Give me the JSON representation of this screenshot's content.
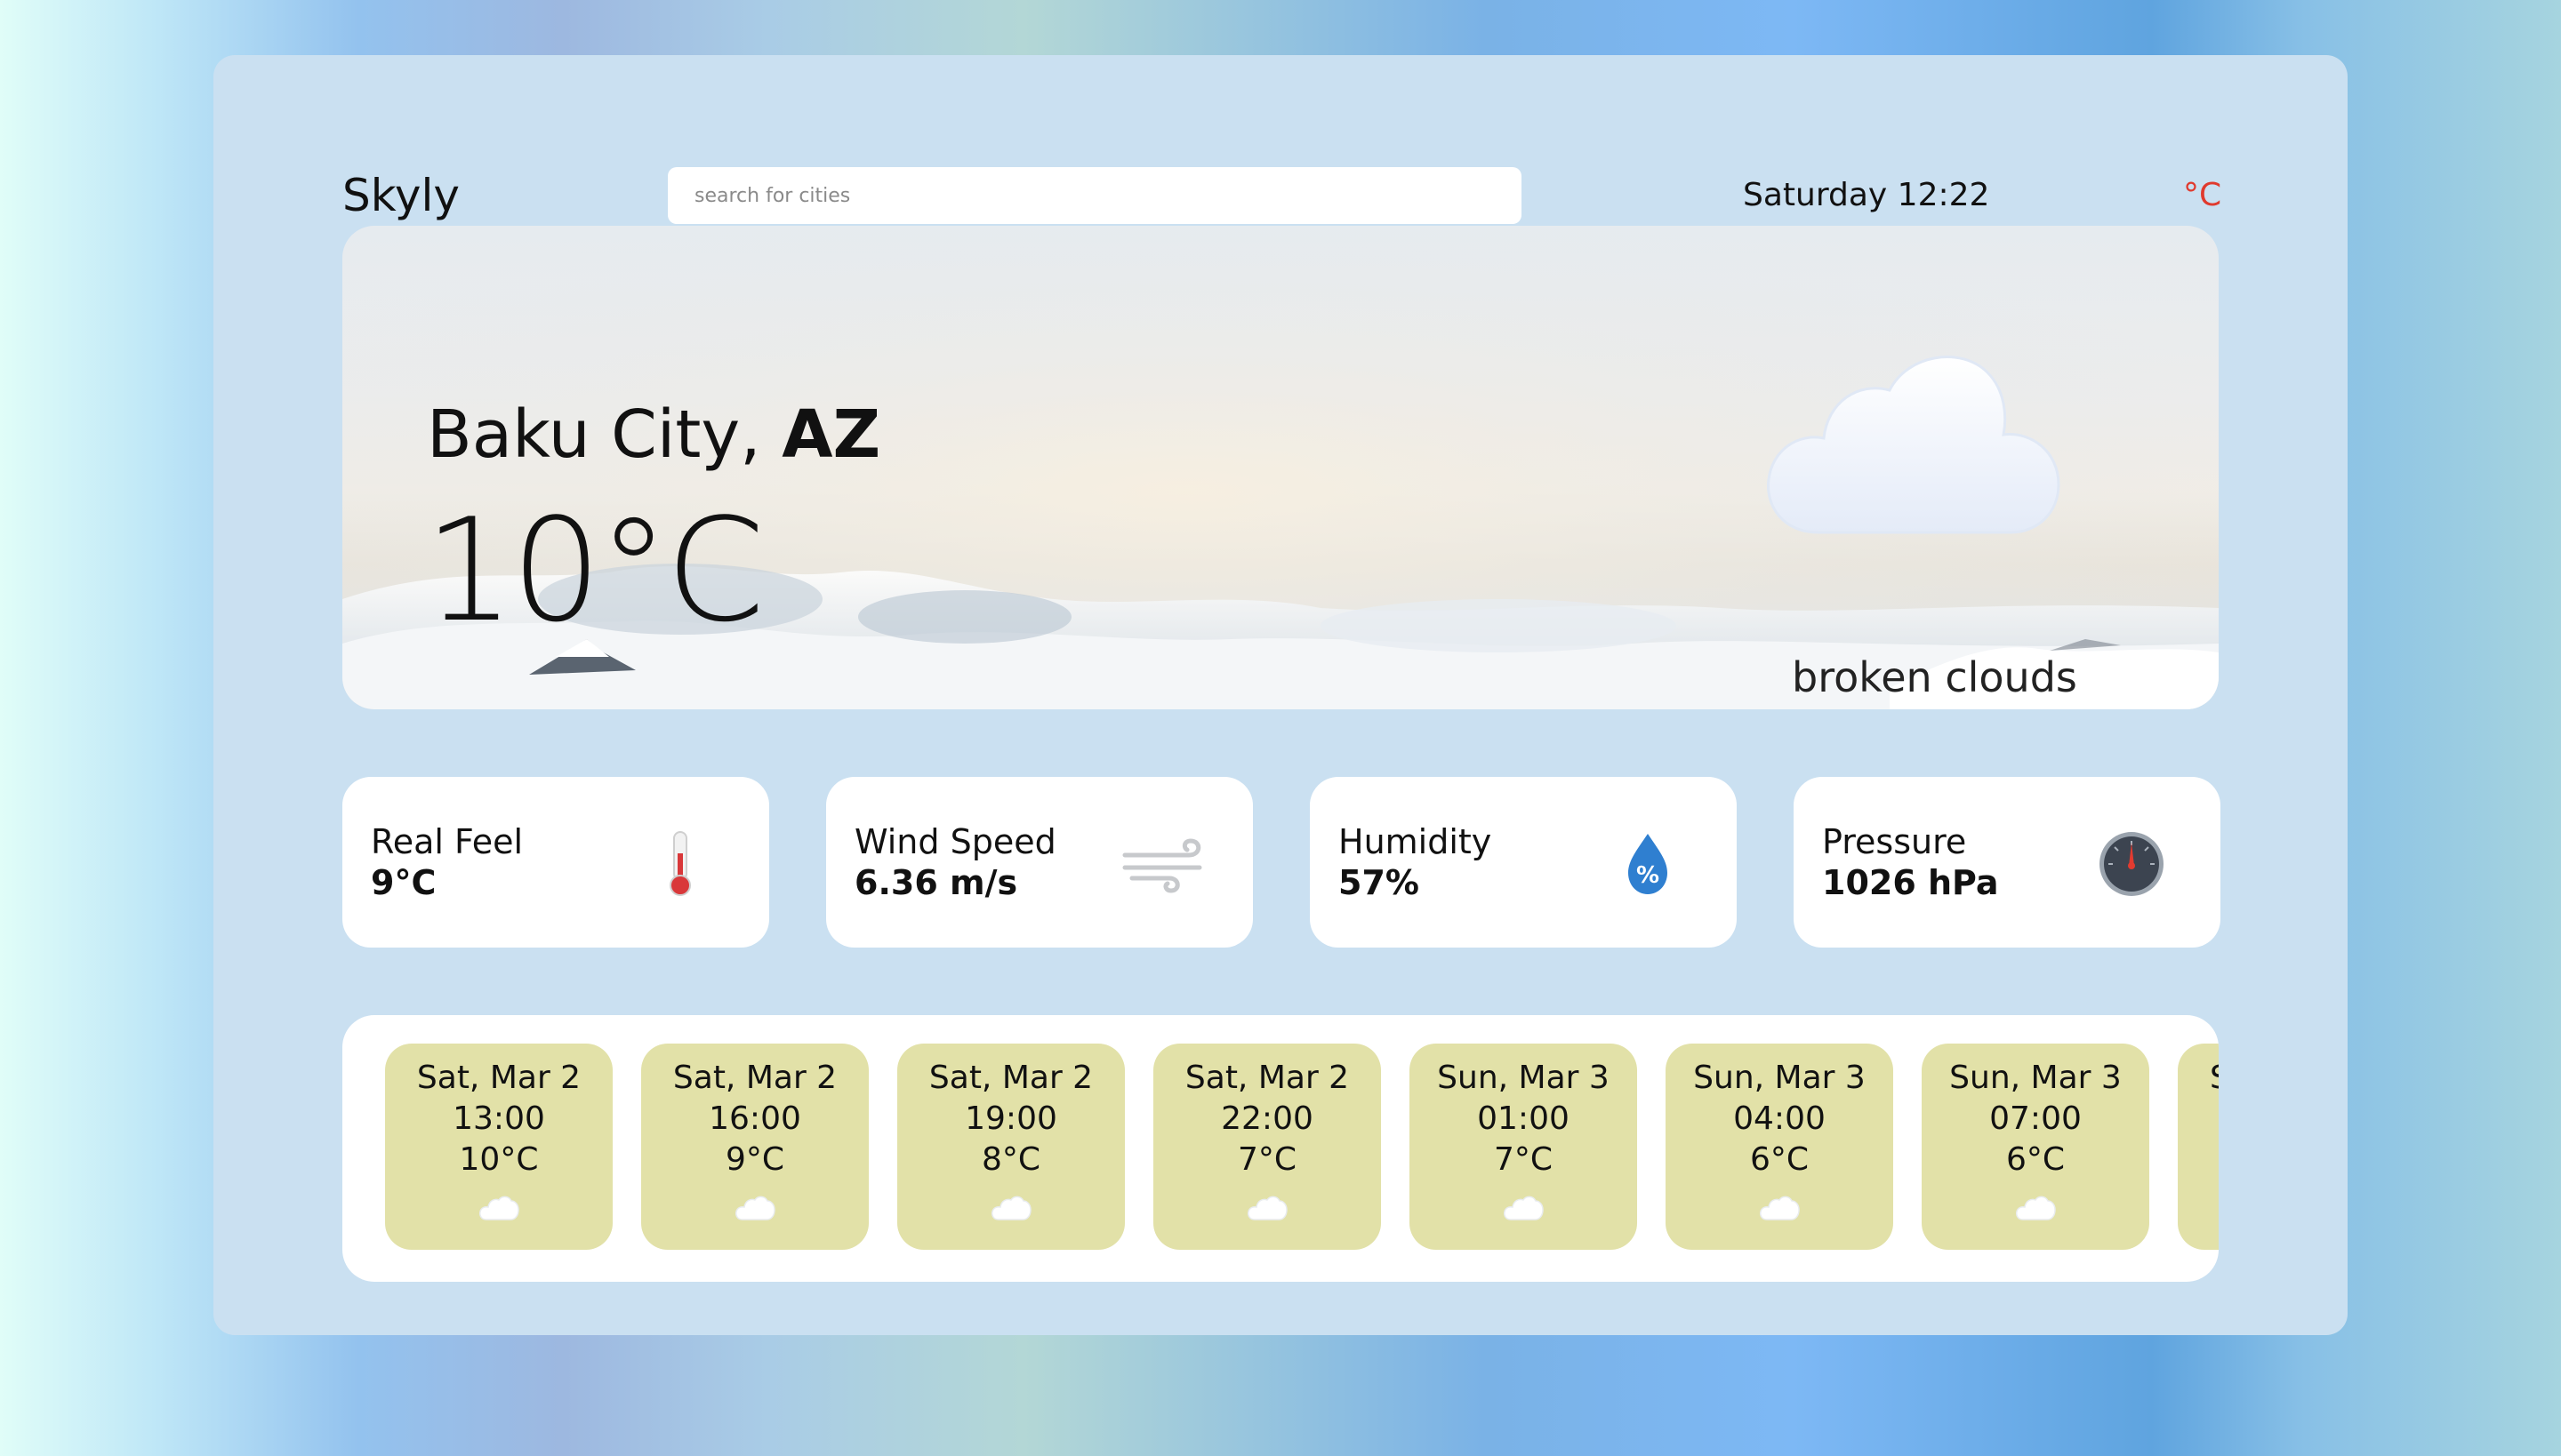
{
  "app": {
    "brand": "Skyly"
  },
  "search": {
    "placeholder": "search for cities",
    "value": ""
  },
  "header": {
    "datetime": "Saturday 12:22",
    "unit_toggle": "°C"
  },
  "hero": {
    "city": "Baku City,",
    "country": "AZ",
    "temperature": "10°C",
    "description": "broken clouds",
    "icon": "cloud-icon"
  },
  "stats": [
    {
      "label": "Real Feel",
      "value": "9°C",
      "icon": "thermometer-icon"
    },
    {
      "label": "Wind Speed",
      "value": "6.36 m/s",
      "icon": "wind-icon"
    },
    {
      "label": "Humidity",
      "value": "57%",
      "icon": "humidity-drop-icon"
    },
    {
      "label": "Pressure",
      "value": "1026 hPa",
      "icon": "pressure-gauge-icon"
    }
  ],
  "forecast": [
    {
      "date": "Sat, Mar 2",
      "time": "13:00",
      "temp": "10°C",
      "icon": "cloud-icon"
    },
    {
      "date": "Sat, Mar 2",
      "time": "16:00",
      "temp": "9°C",
      "icon": "cloud-icon"
    },
    {
      "date": "Sat, Mar 2",
      "time": "19:00",
      "temp": "8°C",
      "icon": "cloud-icon"
    },
    {
      "date": "Sat, Mar 2",
      "time": "22:00",
      "temp": "7°C",
      "icon": "cloud-icon"
    },
    {
      "date": "Sun, Mar 3",
      "time": "01:00",
      "temp": "7°C",
      "icon": "cloud-icon"
    },
    {
      "date": "Sun, Mar 3",
      "time": "04:00",
      "temp": "6°C",
      "icon": "cloud-icon"
    },
    {
      "date": "Sun, Mar 3",
      "time": "07:00",
      "temp": "6°C",
      "icon": "cloud-icon"
    },
    {
      "date": "S",
      "time": "",
      "temp": "",
      "icon": "cloud-icon"
    }
  ],
  "colors": {
    "panel": "#cae0f1",
    "accent_unit": "#e03a2e",
    "forecast_slot": "#e2e1a8"
  }
}
